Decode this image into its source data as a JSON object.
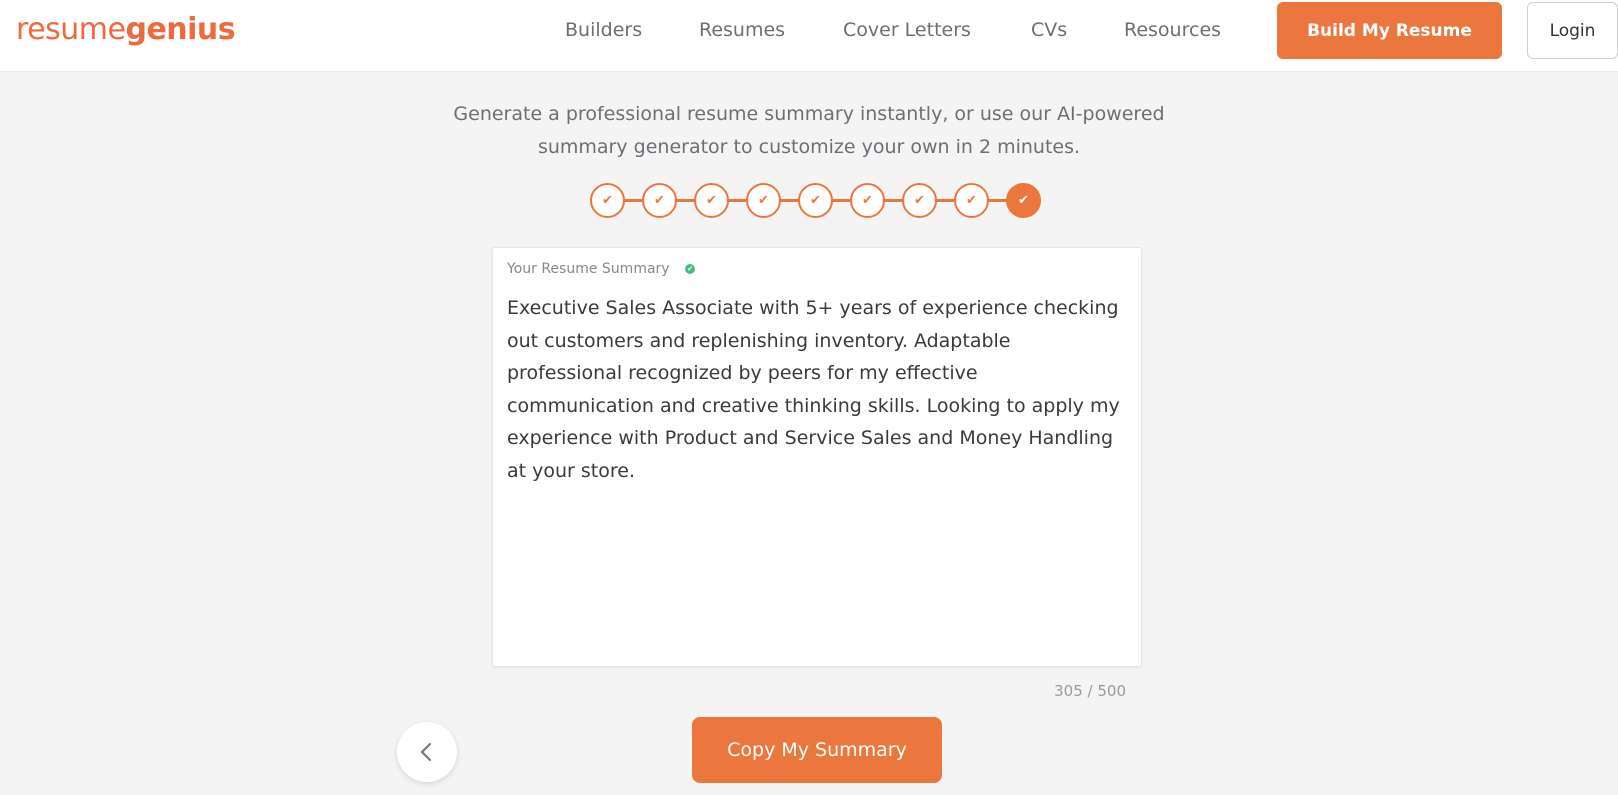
{
  "brand": {
    "logo_light": "resume",
    "logo_bold": "genius",
    "accent_color": "#ec773e"
  },
  "nav": {
    "items": [
      {
        "label": "Builders"
      },
      {
        "label": "Resumes"
      },
      {
        "label": "Cover Letters"
      },
      {
        "label": "CVs"
      },
      {
        "label": "Resources"
      }
    ],
    "build_label": "Build My Resume",
    "login_label": "Login"
  },
  "intro": {
    "line1": "Generate a professional resume summary instantly, or use our AI-powered",
    "line2": "summary generator to customize your own in 2 minutes."
  },
  "progress": {
    "total_steps": 9,
    "completed_steps": 9,
    "current_step": 9,
    "check_glyph": "✔"
  },
  "summary": {
    "label": "Your Resume Summary",
    "text": "Executive Sales Associate with 5+ years of experience checking out customers and replenishing inventory. Adaptable professional recognized by peers for my effective communication and creative thinking skills. Looking to apply my experience with Product and Service Sales and Money Handling at your store.",
    "counter": "305 / 500"
  },
  "actions": {
    "copy_label": "Copy My Summary",
    "back_icon": "chevron-left-icon"
  }
}
